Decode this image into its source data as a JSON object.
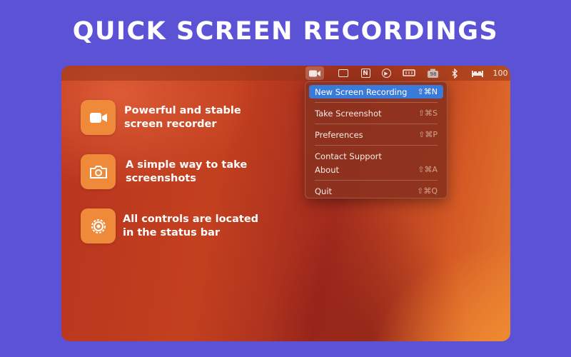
{
  "headline": "QUICK SCREEN RECORDINGS",
  "menubar": {
    "items": [
      {
        "name": "video-camera-icon",
        "active": true
      },
      {
        "name": "grid-icon"
      },
      {
        "name": "notion-icon",
        "text": "N"
      },
      {
        "name": "play-circle-icon"
      },
      {
        "name": "memory-icon"
      },
      {
        "name": "battery-icon",
        "text": "98"
      },
      {
        "name": "bluetooth-icon"
      },
      {
        "name": "bed-icon"
      }
    ],
    "trailing_text": "100"
  },
  "features": [
    {
      "icon": "video-camera-icon",
      "text": "Powerful and stable screen recorder"
    },
    {
      "icon": "camera-icon",
      "text": "A simple way to take screenshots"
    },
    {
      "icon": "gear-icon",
      "text": "All controls are located in the status bar"
    }
  ],
  "menu": {
    "new_recording": {
      "label": "New Screen Recording",
      "shortcut": "⇧⌘N"
    },
    "take_screenshot": {
      "label": "Take Screenshot",
      "shortcut": "⇧⌘S"
    },
    "preferences": {
      "label": "Preferences",
      "shortcut": "⇧⌘P"
    },
    "contact_support": {
      "label": "Contact Support",
      "shortcut": ""
    },
    "about": {
      "label": "About",
      "shortcut": "⇧⌘A"
    },
    "quit": {
      "label": "Quit",
      "shortcut": "⇧⌘Q"
    }
  },
  "colors": {
    "background": "#5b52d6",
    "feature_icon_bg": "#ef8a3a",
    "menu_highlight": "#3a7ad8"
  }
}
